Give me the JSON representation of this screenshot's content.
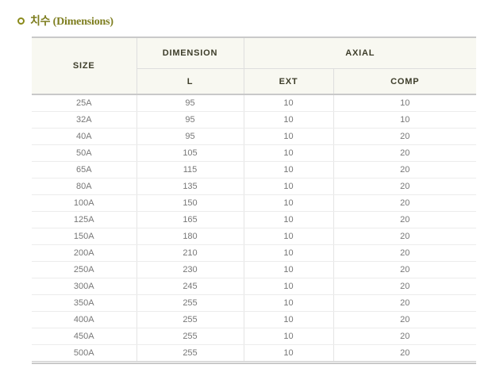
{
  "section": {
    "title": "치수 (Dimensions)"
  },
  "table": {
    "headers": {
      "size": "SIZE",
      "dimension": "DIMENSION",
      "axial": "AXIAL",
      "l": "L",
      "ext": "EXT",
      "comp": "COMP"
    },
    "rows": [
      {
        "size": "25A",
        "l": "95",
        "ext": "10",
        "comp": "10"
      },
      {
        "size": "32A",
        "l": "95",
        "ext": "10",
        "comp": "10"
      },
      {
        "size": "40A",
        "l": "95",
        "ext": "10",
        "comp": "20"
      },
      {
        "size": "50A",
        "l": "105",
        "ext": "10",
        "comp": "20"
      },
      {
        "size": "65A",
        "l": "115",
        "ext": "10",
        "comp": "20"
      },
      {
        "size": "80A",
        "l": "135",
        "ext": "10",
        "comp": "20"
      },
      {
        "size": "100A",
        "l": "150",
        "ext": "10",
        "comp": "20"
      },
      {
        "size": "125A",
        "l": "165",
        "ext": "10",
        "comp": "20"
      },
      {
        "size": "150A",
        "l": "180",
        "ext": "10",
        "comp": "20"
      },
      {
        "size": "200A",
        "l": "210",
        "ext": "10",
        "comp": "20"
      },
      {
        "size": "250A",
        "l": "230",
        "ext": "10",
        "comp": "20"
      },
      {
        "size": "300A",
        "l": "245",
        "ext": "10",
        "comp": "20"
      },
      {
        "size": "350A",
        "l": "255",
        "ext": "10",
        "comp": "20"
      },
      {
        "size": "400A",
        "l": "255",
        "ext": "10",
        "comp": "20"
      },
      {
        "size": "450A",
        "l": "255",
        "ext": "10",
        "comp": "20"
      },
      {
        "size": "500A",
        "l": "255",
        "ext": "10",
        "comp": "20"
      }
    ]
  },
  "colors": {
    "title": "#7d7d1e",
    "header_bg": "#f8f8f1",
    "header_text": "#3d3d2a",
    "cell_text": "#777777"
  },
  "icons": {
    "bullet": "ring-bullet-icon"
  }
}
